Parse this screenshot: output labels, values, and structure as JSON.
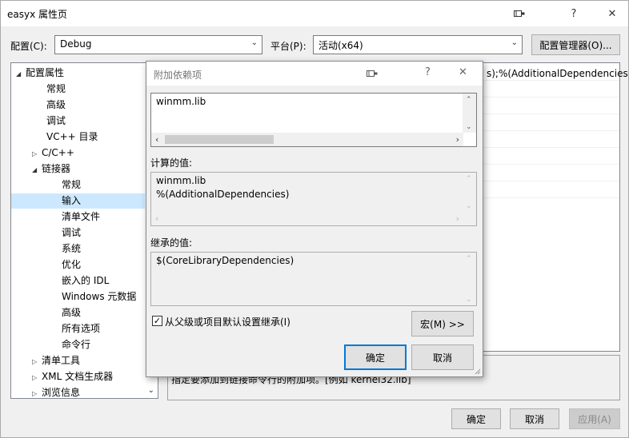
{
  "window": {
    "title": "easyx 属性页",
    "help_glyph": "?",
    "close_glyph": "✕"
  },
  "config": {
    "config_label": "配置(C):",
    "config_value": "Debug",
    "platform_label": "平台(P):",
    "platform_value": "活动(x64)",
    "manager_button": "配置管理器(O)..."
  },
  "tree": {
    "items": [
      {
        "label": "配置属性",
        "caret": "◢"
      },
      {
        "label": "常规",
        "caret": ""
      },
      {
        "label": "高级",
        "caret": ""
      },
      {
        "label": "调试",
        "caret": ""
      },
      {
        "label": "VC++ 目录",
        "caret": ""
      },
      {
        "label": "C/C++",
        "caret": "▷"
      },
      {
        "label": "链接器",
        "caret": "◢"
      },
      {
        "label": "常规",
        "caret": ""
      },
      {
        "label": "输入",
        "caret": ""
      },
      {
        "label": "清单文件",
        "caret": ""
      },
      {
        "label": "调试",
        "caret": ""
      },
      {
        "label": "系统",
        "caret": ""
      },
      {
        "label": "优化",
        "caret": ""
      },
      {
        "label": "嵌入的 IDL",
        "caret": ""
      },
      {
        "label": "Windows 元数据",
        "caret": ""
      },
      {
        "label": "高级",
        "caret": ""
      },
      {
        "label": "所有选项",
        "caret": ""
      },
      {
        "label": "命令行",
        "caret": ""
      },
      {
        "label": "清单工具",
        "caret": "▷"
      },
      {
        "label": "XML 文档生成器",
        "caret": "▷"
      },
      {
        "label": "浏览信息",
        "caret": "▷"
      }
    ],
    "selected_index": 8
  },
  "grid": {
    "first_row_value": "s);%(AdditionalDependencies"
  },
  "description": {
    "text": "指定要添加到链接命令行的附加项。[例如 kernel32.lib]"
  },
  "footer": {
    "ok": "确定",
    "cancel": "取消",
    "apply": "应用(A)"
  },
  "dialog": {
    "title": "附加依赖项",
    "help_glyph": "?",
    "close_glyph": "✕",
    "input_value": "winmm.lib",
    "computed_label": "计算的值:",
    "computed_lines": [
      "winmm.lib",
      "%(AdditionalDependencies)"
    ],
    "inherited_label": "继承的值:",
    "inherited_lines": [
      "$(CoreLibraryDependencies)"
    ],
    "inherit_checkbox_label": "从父级或项目默认设置继承(I)",
    "inherit_checked": true,
    "check_glyph": "✓",
    "macro_button": "宏(M) >>",
    "ok": "确定",
    "cancel": "取消"
  }
}
